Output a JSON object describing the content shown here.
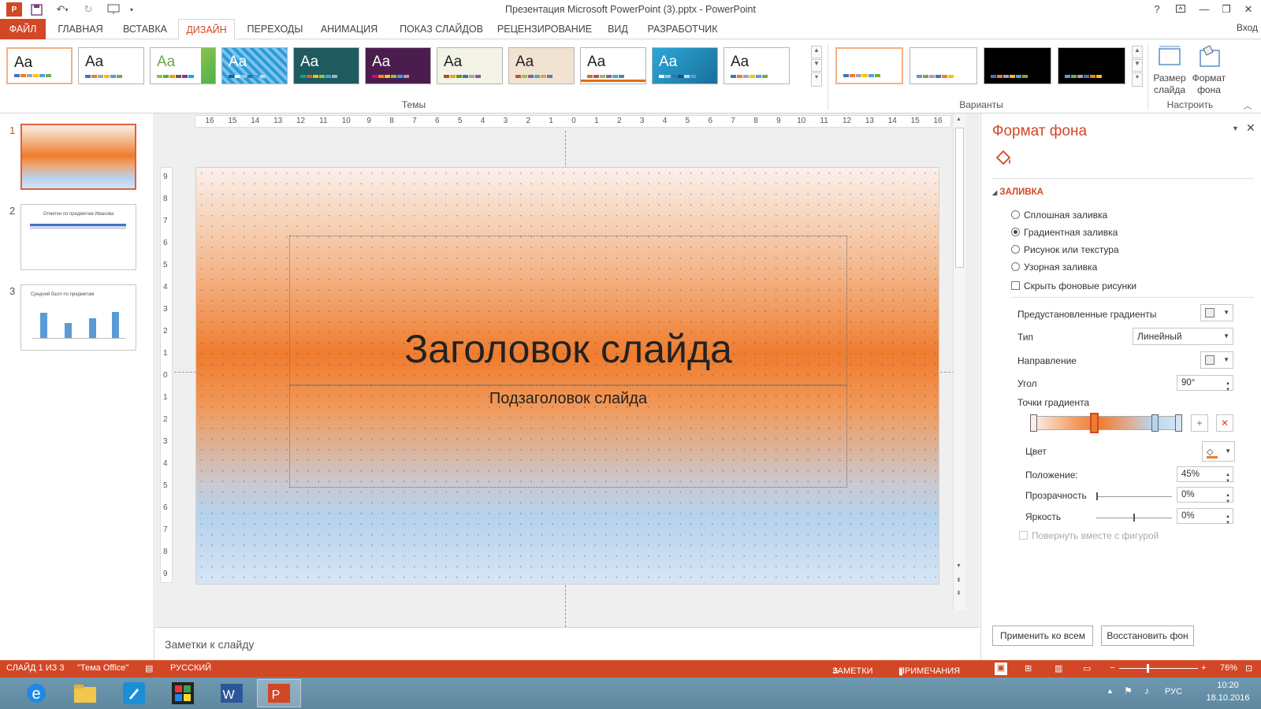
{
  "window": {
    "title": "Презентация Microsoft PowerPoint (3).pptx - PowerPoint",
    "help": "?",
    "login": "Вход"
  },
  "tabs": [
    "ФАЙЛ",
    "ГЛАВНАЯ",
    "ВСТАВКА",
    "ДИЗАЙН",
    "ПЕРЕХОДЫ",
    "АНИМАЦИЯ",
    "ПОКАЗ СЛАЙДОВ",
    "РЕЦЕНЗИРОВАНИЕ",
    "ВИД",
    "РАЗРАБОТЧИК"
  ],
  "active_tab": "ДИЗАЙН",
  "ribbon": {
    "themes_label": "Темы",
    "variants_label": "Варианты",
    "customize_label": "Настроить",
    "theme_sample": "Aa",
    "slide_size": "Размер слайда",
    "format_bg": "Формат фона",
    "theme_colors": [
      "#ffffff",
      "#ffffff",
      "#ffffff",
      "#2a9bd8",
      "#1f5a5e",
      "#4b1d4f",
      "#f3f3e6",
      "#f1e3d1",
      "#ffffff",
      "#2aa9d9",
      "#ffffff"
    ]
  },
  "slides": [
    {
      "num": "1"
    },
    {
      "num": "2",
      "title": "Отметки по предметам Иванова"
    },
    {
      "num": "3",
      "title": "Средний балл по предметам"
    }
  ],
  "ruler": {
    "h": [
      "16",
      "15",
      "14",
      "13",
      "12",
      "11",
      "10",
      "9",
      "8",
      "7",
      "6",
      "5",
      "4",
      "3",
      "2",
      "1",
      "0",
      "1",
      "2",
      "3",
      "4",
      "5",
      "6",
      "7",
      "8",
      "9",
      "10",
      "11",
      "12",
      "13",
      "14",
      "15",
      "16"
    ],
    "v": [
      "9",
      "8",
      "7",
      "6",
      "5",
      "4",
      "3",
      "2",
      "1",
      "0",
      "1",
      "2",
      "3",
      "4",
      "5",
      "6",
      "7",
      "8",
      "9"
    ]
  },
  "slide": {
    "title": "Заголовок слайда",
    "subtitle": "Подзаголовок слайда"
  },
  "notes_placeholder": "Заметки к слайду",
  "format_pane": {
    "title": "Формат фона",
    "section": "ЗАЛИВКА",
    "options": [
      "Сплошная заливка",
      "Градиентная заливка",
      "Рисунок или текстура",
      "Узорная заливка"
    ],
    "selected_option": "Градиентная заливка",
    "hide_bg": "Скрыть фоновые рисунки",
    "preset": "Предустановленные градиенты",
    "type_label": "Тип",
    "type_value": "Линейный",
    "direction": "Направление",
    "angle_label": "Угол",
    "angle_value": "90°",
    "stops_label": "Точки градиента",
    "color_label": "Цвет",
    "position_label": "Положение:",
    "position_value": "45%",
    "transparency_label": "Прозрачность",
    "transparency_value": "0%",
    "brightness_label": "Яркость",
    "brightness_value": "0%",
    "rotate_with_shape": "Повернуть вместе с фигурой",
    "apply_all": "Применить ко всем",
    "reset_bg": "Восстановить фон"
  },
  "statusbar": {
    "slide_info": "СЛАЙД 1 ИЗ 3",
    "theme": "\"Тема Office\"",
    "language": "РУССКИЙ",
    "notes": "ЗАМЕТКИ",
    "comments": "ПРИМЕЧАНИЯ",
    "zoom": "76%"
  },
  "taskbar": {
    "lang": "РУС",
    "time": "10:20",
    "date": "18.10.2016"
  }
}
